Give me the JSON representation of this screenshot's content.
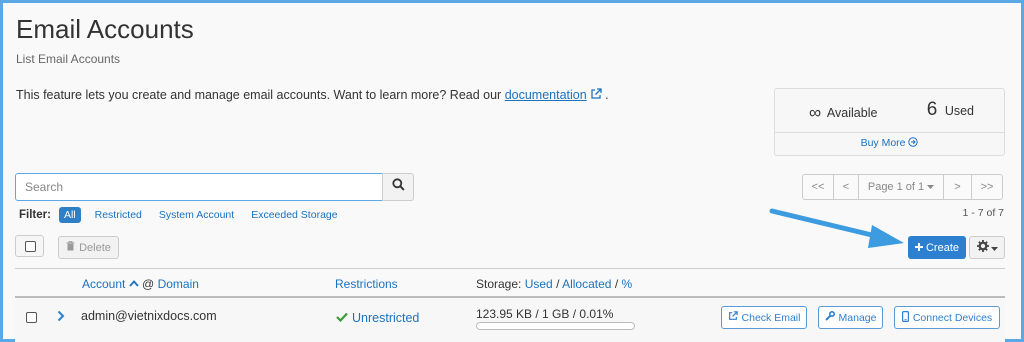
{
  "header": {
    "title": "Email Accounts",
    "subtitle": "List Email Accounts",
    "intro_text": "This feature lets you create and manage email accounts. Want to learn more? Read our ",
    "doc_link": "documentation",
    "intro_end": " ."
  },
  "stats": {
    "available_symbol": "∞",
    "available_label": "Available",
    "used_count": "6",
    "used_label": "Used",
    "buy_more": "Buy More"
  },
  "search": {
    "placeholder": "Search"
  },
  "filter": {
    "label": "Filter:",
    "options": [
      "All",
      "Restricted",
      "System Account",
      "Exceeded Storage"
    ],
    "active": "All"
  },
  "pagination": {
    "first": "<<",
    "prev": "<",
    "page_label": "Page 1 of 1",
    "next": ">",
    "last": ">>",
    "range": "1 - 7 of 7"
  },
  "actions": {
    "delete": "Delete",
    "create": "Create"
  },
  "table": {
    "col_account": "Account",
    "col_at": "@",
    "col_domain": "Domain",
    "col_restrictions": "Restrictions",
    "col_storage_prefix": "Storage:",
    "col_used": "Used",
    "col_sep1": "/",
    "col_allocated": "Allocated",
    "col_sep2": "/",
    "col_pct": "%",
    "rows": [
      {
        "email": "admin@vietnixdocs.com",
        "restriction": "Unrestricted",
        "storage": "123.95 KB / 1 GB / 0.01%",
        "usage_fraction": 0.0001,
        "check_email": "Check Email",
        "manage": "Manage",
        "connect": "Connect Devices"
      }
    ]
  },
  "colors": {
    "accent": "#2d7fd0",
    "link": "#1a72c1",
    "frame": "#5aa8e6",
    "success": "#3c9a3c",
    "arrow": "#3d9be0"
  }
}
